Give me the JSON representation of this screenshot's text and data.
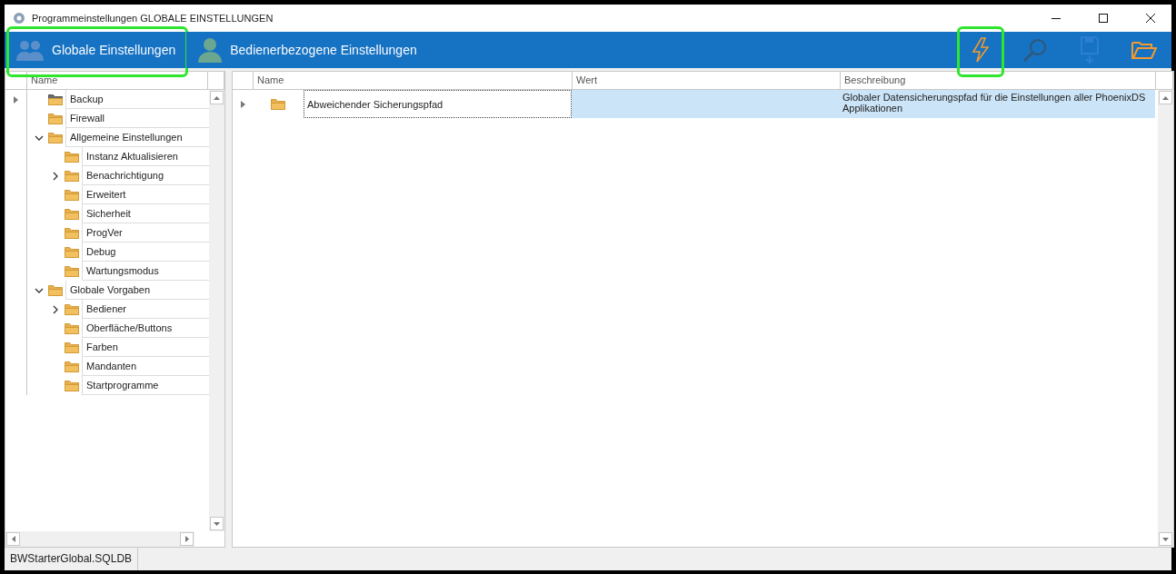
{
  "window": {
    "title": "Programmeinstellungen GLOBALE EINSTELLUNGEN"
  },
  "toolbar": {
    "tabs": [
      {
        "label": "Globale Einstellungen",
        "highlighted": true
      },
      {
        "label": "Bedienerbezogene Einstellungen",
        "highlighted": false
      }
    ],
    "actions": [
      {
        "kind": "flash",
        "disabled": false,
        "highlighted": true
      },
      {
        "kind": "search",
        "disabled": true,
        "highlighted": false
      },
      {
        "kind": "save",
        "disabled": true,
        "highlighted": false
      },
      {
        "kind": "open",
        "disabled": false,
        "highlighted": false
      }
    ]
  },
  "tree": {
    "column": "Name",
    "items": [
      {
        "name": "Backup",
        "selected": true,
        "expandable": false,
        "expanded": false
      },
      {
        "name": "Firewall",
        "selected": false,
        "expandable": false,
        "expanded": false
      },
      {
        "name": "Allgemeine Einstellungen",
        "selected": false,
        "expandable": true,
        "expanded": true,
        "children": [
          {
            "name": "Instanz Aktualisieren",
            "selected": false,
            "expandable": false,
            "expanded": false
          },
          {
            "name": "Benachrichtigung",
            "selected": false,
            "expandable": true,
            "expanded": false
          },
          {
            "name": "Erweitert",
            "selected": false,
            "expandable": false,
            "expanded": false
          },
          {
            "name": "Sicherheit",
            "selected": false,
            "expandable": false,
            "expanded": false
          },
          {
            "name": "ProgVer",
            "selected": false,
            "expandable": false,
            "expanded": false
          },
          {
            "name": "Debug",
            "selected": false,
            "expandable": false,
            "expanded": false
          },
          {
            "name": "Wartungsmodus",
            "selected": false,
            "expandable": false,
            "expanded": false
          }
        ]
      },
      {
        "name": "Globale Vorgaben",
        "selected": false,
        "expandable": true,
        "expanded": true,
        "children": [
          {
            "name": "Bediener",
            "selected": false,
            "expandable": true,
            "expanded": false
          },
          {
            "name": "Oberfläche/Buttons",
            "selected": false,
            "expandable": false,
            "expanded": false
          },
          {
            "name": "Farben",
            "selected": false,
            "expandable": false,
            "expanded": false
          },
          {
            "name": "Mandanten",
            "selected": false,
            "expandable": false,
            "expanded": false
          },
          {
            "name": "Startprogramme",
            "selected": false,
            "expandable": false,
            "expanded": false
          }
        ]
      }
    ]
  },
  "grid": {
    "columns": [
      "Name",
      "Wert",
      "Beschreibung"
    ],
    "rows": [
      {
        "selected": true,
        "name": "Abweichender Sicherungspfad",
        "description": "Globaler Datensicherungspfad für die Einstellungen aller PhoenixDS Applikationen"
      }
    ]
  },
  "status_bar": "BWStarterGlobal.SQLDB"
}
